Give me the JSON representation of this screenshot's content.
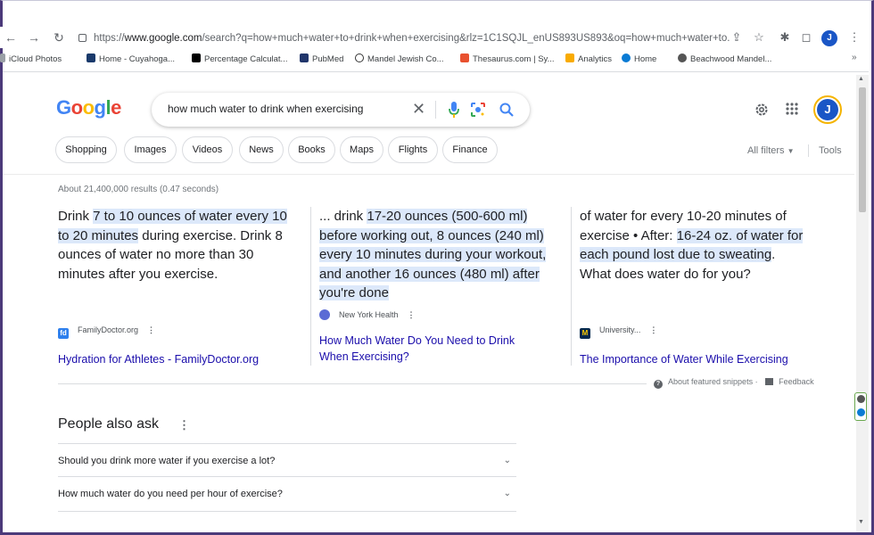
{
  "browser": {
    "url_prefix": "https://",
    "url_host": "www.google.com",
    "url_rest": "/search?q=how+much+water+to+drink+when+exercising&rlz=1C1SQJL_enUS893US893&oq=how+much+water+to...",
    "profile_initial": "J"
  },
  "bookmarks": [
    {
      "label": "iCloud Photos",
      "icon_color": "#9aa0a6"
    },
    {
      "label": "Home - Cuyahoga...",
      "icon_color": "#1a3a6b"
    },
    {
      "label": "Percentage Calculat...",
      "icon_color": "#000000"
    },
    {
      "label": "PubMed",
      "icon_color": "#21366b"
    },
    {
      "label": "Mandel Jewish Co...",
      "icon_color": "#333333"
    },
    {
      "label": "Thesaurus.com | Sy...",
      "icon_color": "#e8512f"
    },
    {
      "label": "Analytics",
      "icon_color": "#f9ab00"
    },
    {
      "label": "Home",
      "icon_color": "#0a7bd4"
    },
    {
      "label": "Beachwood Mandel...",
      "icon_color": "#555555"
    }
  ],
  "google": {
    "logo_letters": [
      "G",
      "o",
      "o",
      "g",
      "l",
      "e"
    ],
    "logo_colors": [
      "#4285F4",
      "#EA4335",
      "#FBBC05",
      "#4285F4",
      "#34A853",
      "#EA4335"
    ],
    "query": "how much water to drink when exercising",
    "clear": "✕",
    "avatar_initial": "J"
  },
  "chips": [
    "Shopping",
    "Images",
    "Videos",
    "News",
    "Books",
    "Maps",
    "Flights",
    "Finance"
  ],
  "all_filters": "All filters",
  "tools": "Tools",
  "result_stats": "About 21,400,000 results (0.47 seconds)",
  "snippets": [
    {
      "lines": [
        {
          "pre": "Drink ",
          "hl": "7 to 10 ounces of water every 10",
          "post": ""
        },
        {
          "pre": "",
          "hl": "to 20 minutes",
          "post": " during exercise. Drink 8"
        },
        {
          "pre": "ounces of water no more than 30",
          "hl": "",
          "post": ""
        },
        {
          "pre": "minutes after you exercise.",
          "hl": "",
          "post": ""
        }
      ],
      "source": "FamilyDoctor.org",
      "favicon": "fd",
      "favicon_color": "#2f80ed",
      "link": "Hydration for Athletes - FamilyDoctor.org"
    },
    {
      "lines": [
        {
          "pre": "... drink ",
          "hl": "17-20 ounces (500-600 ml)",
          "post": ""
        },
        {
          "pre": "",
          "hl": "before working out, 8 ounces (240 ml)",
          "post": ""
        },
        {
          "pre": "",
          "hl": "every 10 minutes during your workout,",
          "post": ""
        },
        {
          "pre": "",
          "hl": "and another 16 ounces (480 ml) after",
          "post": ""
        },
        {
          "pre": "",
          "hl": "you're done",
          "post": ""
        }
      ],
      "source": "New York Health",
      "favicon": "",
      "favicon_color": "#5b6bd5",
      "link_line1": "How Much Water Do You Need to Drink",
      "link_line2": "When Exercising?"
    },
    {
      "lines": [
        {
          "pre": "of water for every 10-20 minutes of",
          "hl": "",
          "post": ""
        },
        {
          "pre": "exercise • After: ",
          "hl": "16-24 oz",
          "post": ". of water for"
        },
        {
          "pre": "",
          "hl": "each pound lost due to sweating",
          "post": "."
        },
        {
          "pre": "What does water do for you?",
          "hl": "",
          "post": ""
        }
      ],
      "source": "University...",
      "favicon": "M",
      "favicon_color": "#00274c",
      "link": "The Importance of Water While Exercising"
    }
  ],
  "about_snippets": "About featured snippets",
  "feedback": "Feedback",
  "paa": {
    "title": "People also ask",
    "questions": [
      "Should you drink more water if you exercise a lot?",
      "How much water do you need per hour of exercise?"
    ]
  }
}
